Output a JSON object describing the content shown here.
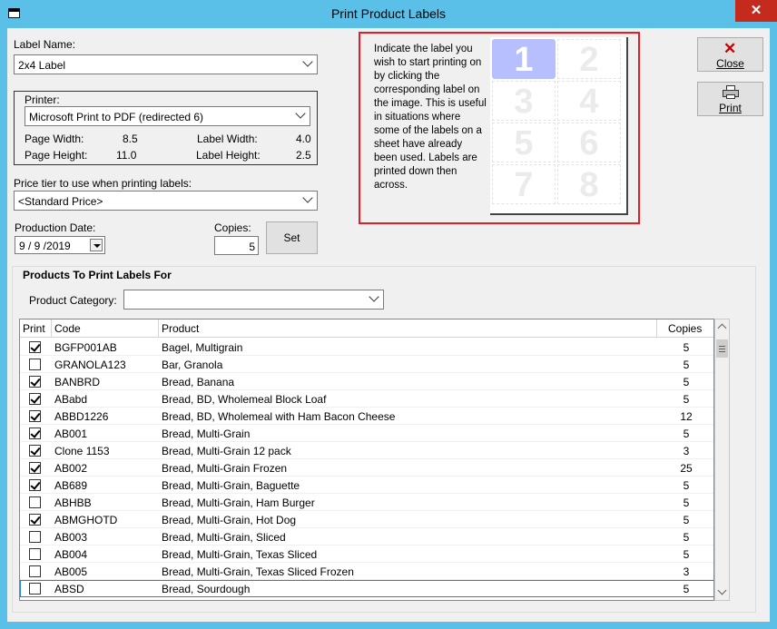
{
  "window": {
    "title": "Print Product Labels",
    "close_glyph": "✕"
  },
  "label_name": {
    "label": "Label Name:",
    "value": "2x4 Label"
  },
  "printer": {
    "label": "Printer:",
    "value": "Microsoft Print to PDF (redirected 6)",
    "page_width_label": "Page Width:",
    "page_width": "8.5",
    "page_height_label": "Page Height:",
    "page_height": "11.0",
    "label_width_label": "Label Width:",
    "label_width": "4.0",
    "label_height_label": "Label Height:",
    "label_height": "2.5"
  },
  "price_tier": {
    "label": "Price tier to use when printing labels:",
    "value": "<Standard Price>"
  },
  "production_date": {
    "label": "Production Date:",
    "value": "9 / 9 /2019"
  },
  "copies": {
    "label": "Copies:",
    "value": "5"
  },
  "set_button": "Set",
  "info": {
    "text": "Indicate the label you wish to start printing on by clicking the corresponding label on the image. This is useful in situations where some of the labels on a sheet have already been used. Labels are printed down then across.",
    "labels": [
      "1",
      "2",
      "3",
      "4",
      "5",
      "6",
      "7",
      "8"
    ],
    "selected": "1"
  },
  "buttons": {
    "close": "Close",
    "print": "Print"
  },
  "products": {
    "title": "Products To Print Labels For",
    "category_label": "Product Category:",
    "category_value": "",
    "columns": {
      "print": "Print",
      "code": "Code",
      "product": "Product",
      "copies": "Copies"
    },
    "rows": [
      {
        "checked": true,
        "code": "BGFP001AB",
        "product": "Bagel, Multigrain",
        "copies": "5"
      },
      {
        "checked": false,
        "code": "GRANOLA123",
        "product": "Bar, Granola",
        "copies": "5"
      },
      {
        "checked": true,
        "code": "BANBRD",
        "product": "Bread, Banana",
        "copies": "5"
      },
      {
        "checked": true,
        "code": "ABabd",
        "product": "Bread, BD, Wholemeal Block Loaf",
        "copies": "5"
      },
      {
        "checked": true,
        "code": "ABBD1226",
        "product": "Bread, BD, Wholemeal with Ham Bacon Cheese",
        "copies": "12"
      },
      {
        "checked": true,
        "code": "AB001",
        "product": "Bread, Multi-Grain",
        "copies": "5"
      },
      {
        "checked": true,
        "code": "Clone 1153",
        "product": "Bread, Multi-Grain 12 pack",
        "copies": "3"
      },
      {
        "checked": true,
        "code": "AB002",
        "product": "Bread, Multi-Grain Frozen",
        "copies": "25"
      },
      {
        "checked": true,
        "code": "AB689",
        "product": "Bread, Multi-Grain, Baguette",
        "copies": "5"
      },
      {
        "checked": false,
        "code": "ABHBB",
        "product": "Bread, Multi-Grain, Ham Burger",
        "copies": "5"
      },
      {
        "checked": true,
        "code": "ABMGHOTD",
        "product": "Bread, Multi-Grain, Hot Dog",
        "copies": "5"
      },
      {
        "checked": false,
        "code": "AB003",
        "product": "Bread, Multi-Grain, Sliced",
        "copies": "5"
      },
      {
        "checked": false,
        "code": "AB004",
        "product": "Bread, Multi-Grain, Texas Sliced",
        "copies": "5"
      },
      {
        "checked": false,
        "code": "AB005",
        "product": "Bread, Multi-Grain, Texas Sliced Frozen",
        "copies": "3"
      },
      {
        "checked": false,
        "code": "ABSD",
        "product": "Bread, Sourdough",
        "copies": "5"
      }
    ]
  }
}
